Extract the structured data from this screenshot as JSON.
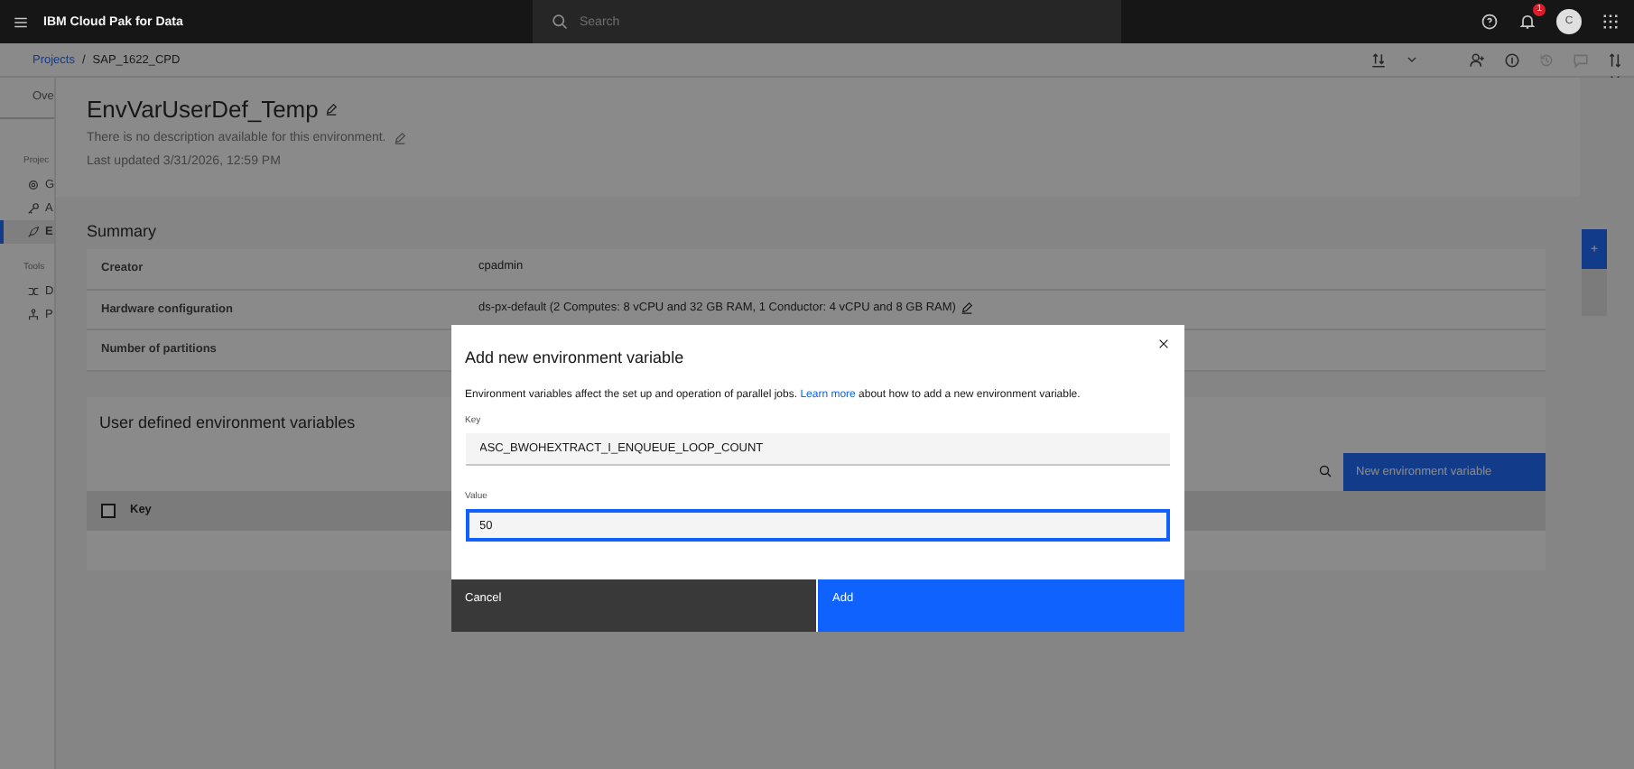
{
  "header": {
    "brand": "IBM Cloud Pak for Data",
    "search": {
      "placeholder": "Search"
    },
    "notification_count": "1",
    "avatar": "C"
  },
  "breadcrumb": {
    "separator": "/",
    "items": [
      {
        "label": "Projects",
        "kind": "link"
      },
      {
        "label": "SAP_1622_CPD",
        "kind": "current"
      }
    ]
  },
  "sidebar": {
    "tab": "Ove",
    "sections": [
      {
        "label": "Projec",
        "items": [
          {
            "label": "G",
            "selected": false
          },
          {
            "label": "A",
            "selected": false
          },
          {
            "label": "E",
            "selected": true
          }
        ]
      },
      {
        "label": "Tools",
        "items": [
          {
            "label": "D",
            "selected": false
          },
          {
            "label": "P",
            "selected": false
          }
        ]
      }
    ]
  },
  "environment": {
    "title": "EnvVarUserDef_Temp",
    "description": "There is no description available for this environment.",
    "last_updated": "Last updated 3/31/2026, 12:59 PM"
  },
  "summary": {
    "heading": "Summary",
    "rows": [
      {
        "label": "Creator",
        "value": "cpadmin"
      },
      {
        "label": "Hardware configuration",
        "value": "ds-px-default (2 Computes: 8 vCPU and 32 GB RAM, 1 Conductor: 4 vCPU and 8 GB RAM)",
        "editable": true
      },
      {
        "label": "Number of partitions"
      }
    ]
  },
  "variables": {
    "heading": "User defined environment variables",
    "new_button": "New environment variable",
    "columns": [
      "Key"
    ],
    "select_all_checked": false
  },
  "side_button": "+",
  "dialog": {
    "title": "Add new environment variable",
    "description_before": "Environment variables affect the set up and operation of parallel jobs.",
    "link": "Learn more",
    "description_after": "about how to add a new environment variable.",
    "fields": [
      {
        "label": "Key",
        "value": "ASC_BWOHEXTRACT_I_ENQUEUE_LOOP_COUNT",
        "focused": false
      },
      {
        "label": "Value",
        "value": "50",
        "focused": true
      }
    ],
    "buttons": [
      {
        "label": "Cancel",
        "kind": "secondary"
      },
      {
        "label": "Add",
        "kind": "primary"
      }
    ]
  }
}
